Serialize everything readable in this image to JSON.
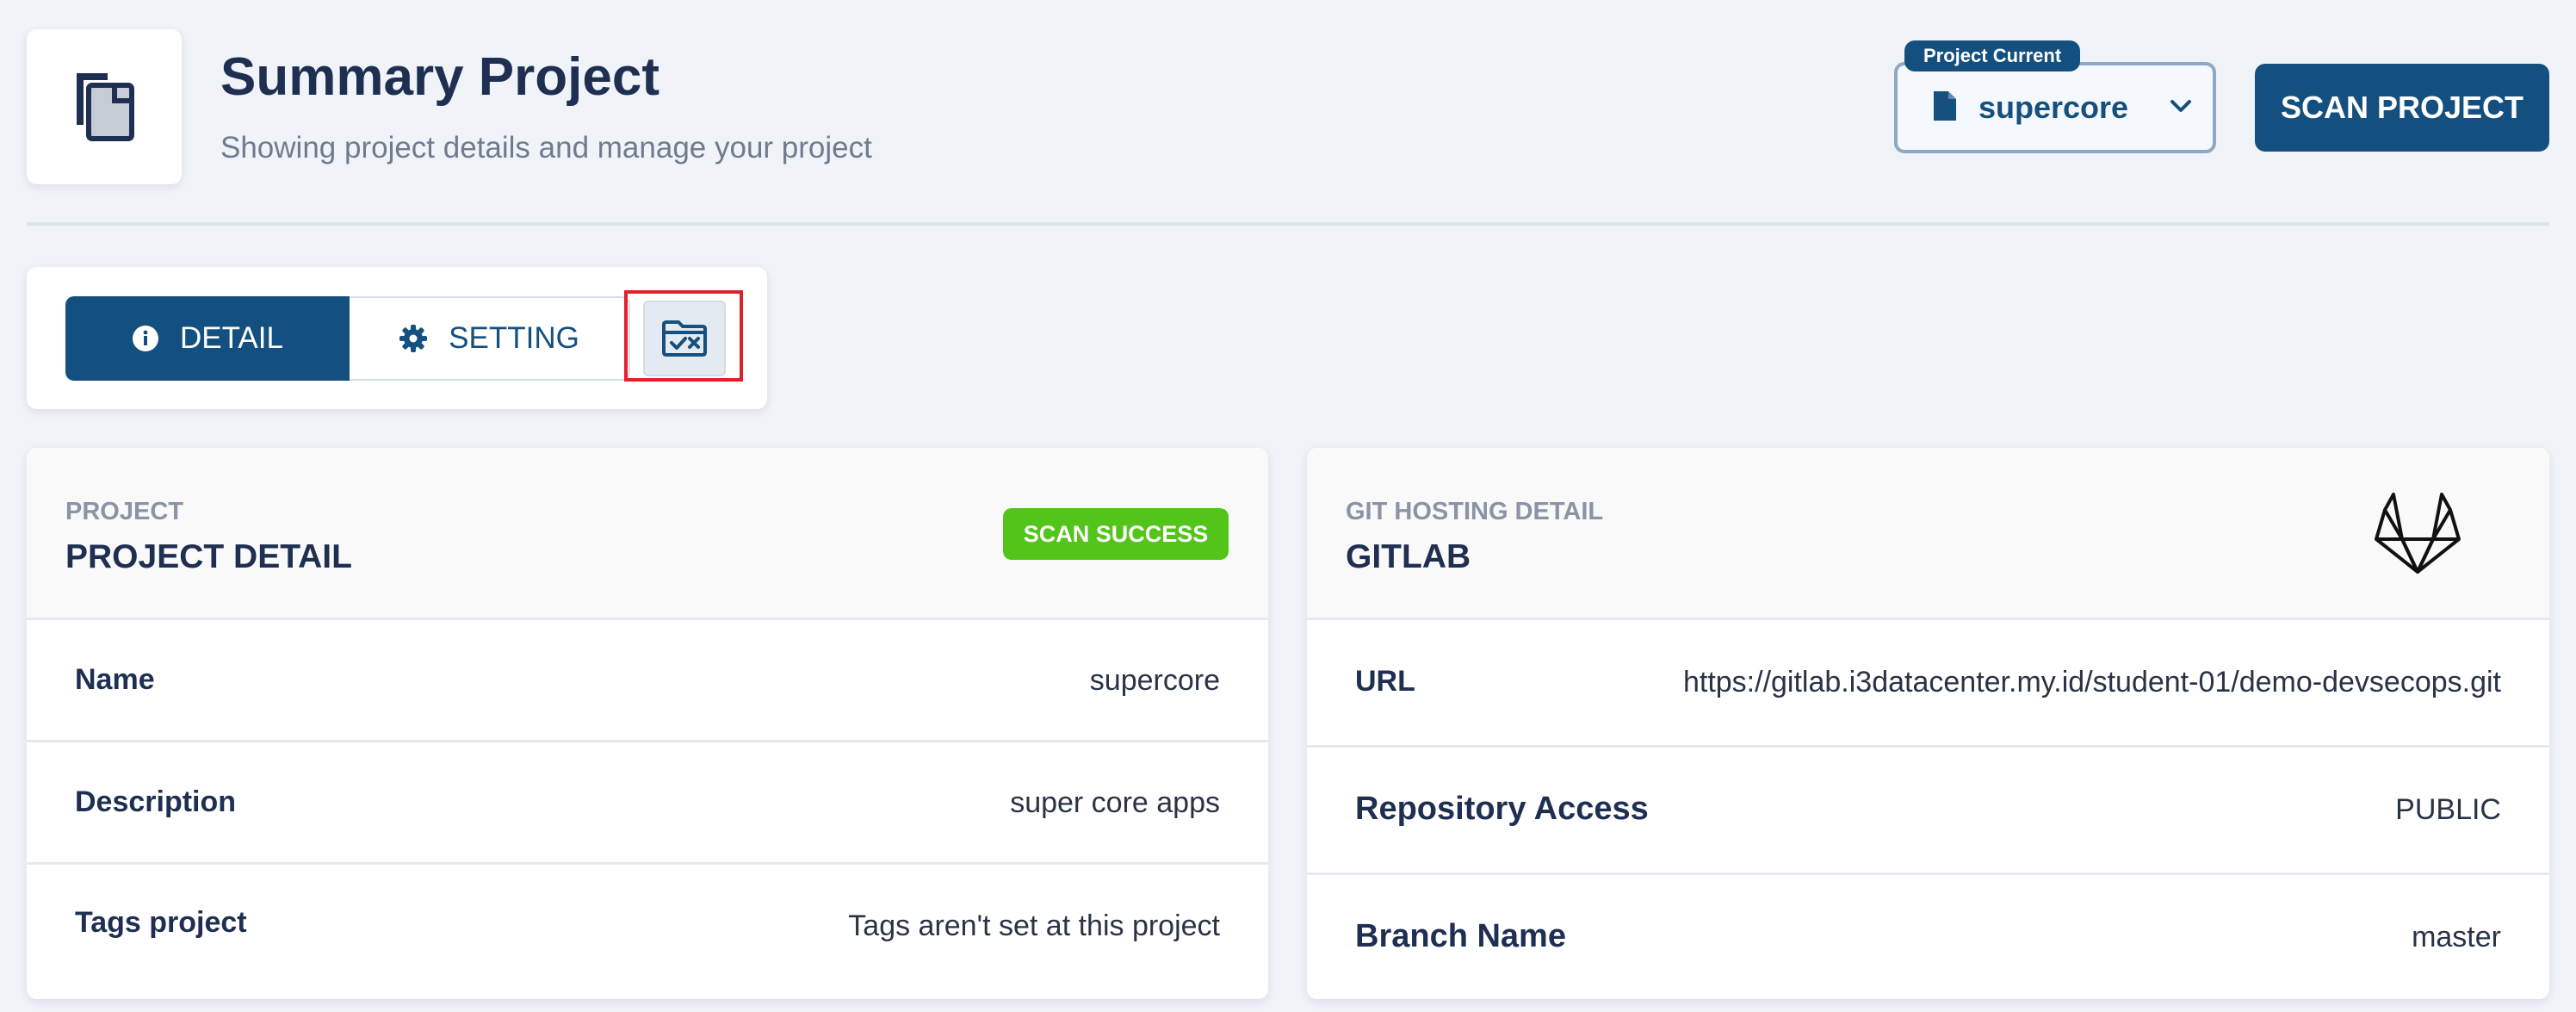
{
  "header": {
    "title": "Summary Project",
    "subtitle": "Showing project details and manage your project",
    "page_icon": "copy-document-icon"
  },
  "project_select": {
    "label": "Project Current",
    "value": "supercore",
    "icon": "file-icon"
  },
  "scan_button": {
    "label": "SCAN PROJECT"
  },
  "tabs": [
    {
      "label": "DETAIL",
      "icon": "info-circle-icon",
      "active": true
    },
    {
      "label": "SETTING",
      "icon": "gear-icon",
      "active": false
    }
  ],
  "extra_tab": {
    "icon": "folder-check-x-icon"
  },
  "project_card": {
    "eyebrow": "PROJECT",
    "title": "PROJECT DETAIL",
    "status": "SCAN SUCCESS",
    "status_color": "#52c41a",
    "rows": [
      {
        "label": "Name",
        "value": "supercore"
      },
      {
        "label": "Description",
        "value": "super core apps"
      },
      {
        "label": "Tags project",
        "value": "Tags aren't set at this project"
      }
    ]
  },
  "git_card": {
    "eyebrow": "GIT HOSTING DETAIL",
    "title": "GITLAB",
    "logo": "gitlab-icon",
    "rows": [
      {
        "label": "URL",
        "value": "https://gitlab.i3datacenter.my.id/student-01/demo-devsecops.git"
      },
      {
        "label": "Repository Access",
        "value": "PUBLIC"
      },
      {
        "label": "Branch Name",
        "value": "master"
      }
    ]
  },
  "colors": {
    "primary": "#13507f",
    "background": "#f0f3f8",
    "success": "#52c41a"
  }
}
